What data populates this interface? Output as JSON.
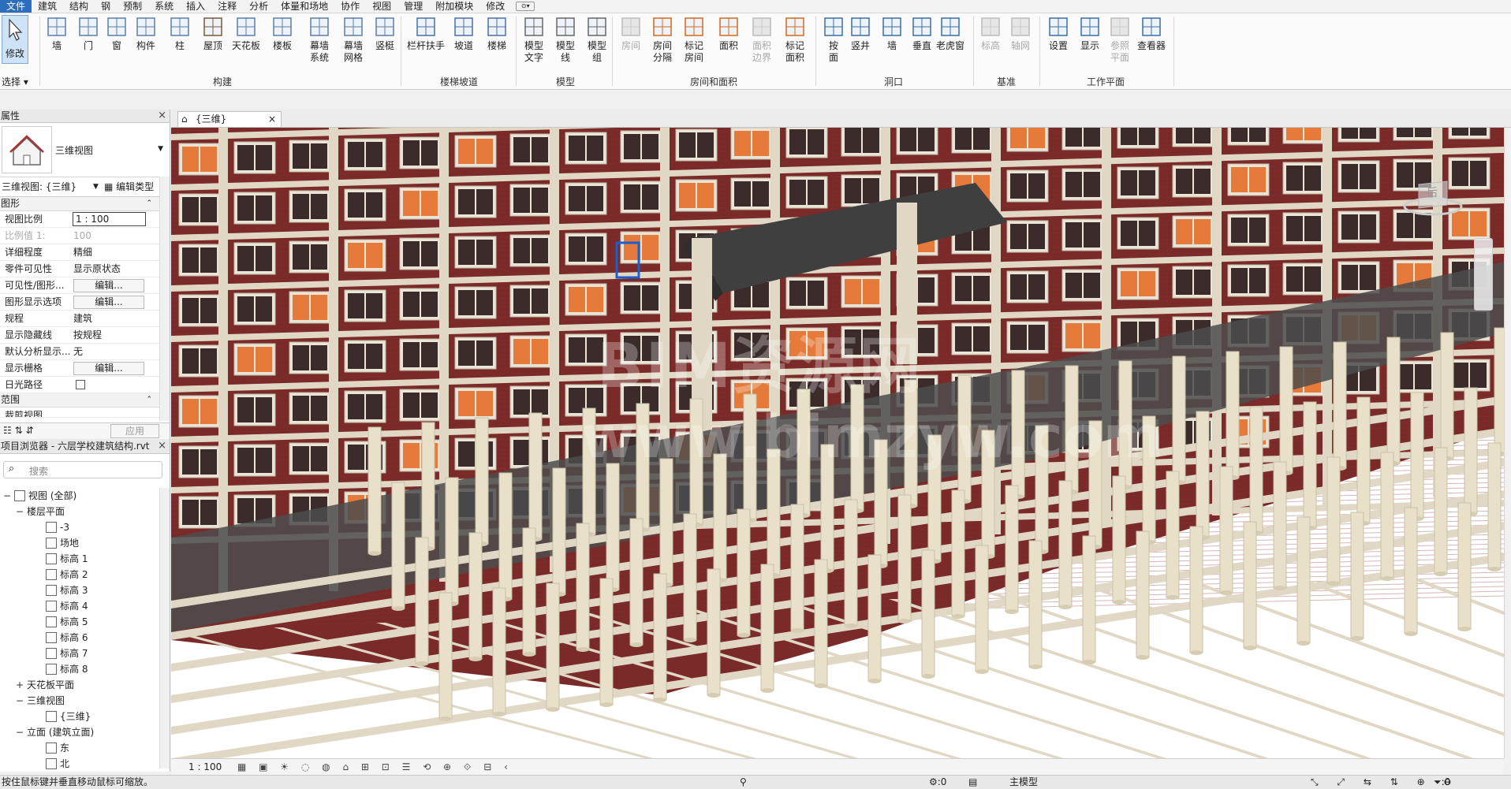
{
  "menu": {
    "items": [
      "文件",
      "建筑",
      "结构",
      "钢",
      "预制",
      "系统",
      "插入",
      "注释",
      "分析",
      "体量和场地",
      "协作",
      "视图",
      "管理",
      "附加模块",
      "修改"
    ]
  },
  "ribbon": {
    "select_label": "选择",
    "modify": "修改",
    "build_buttons": [
      "墙",
      "门",
      "窗",
      "构件",
      "柱",
      "屋顶",
      "天花板",
      "楼板",
      "幕墙\n系统",
      "幕墙\n网格",
      "竖梃"
    ],
    "build_group": "构建",
    "stair_buttons": [
      "栏杆扶手",
      "坡道",
      "楼梯"
    ],
    "stair_group": "楼梯坡道",
    "model_buttons": [
      "模型\n文字",
      "模型\n线",
      "模型\n组"
    ],
    "model_group": "模型",
    "room_buttons": [
      "房间",
      "房间\n分隔",
      "标记\n房间",
      "面积",
      "面积\n边界",
      "标记\n面积"
    ],
    "room_group": "房间和面积",
    "opening_buttons": [
      "按\n面",
      "竖井",
      "墙",
      "垂直",
      "老虎窗"
    ],
    "opening_group": "洞口",
    "datum_buttons": [
      "标高",
      "轴网"
    ],
    "datum_group": "基准",
    "workplane_buttons": [
      "设置",
      "显示",
      "参照\n平面",
      "查看器"
    ],
    "workplane_group": "工作平面"
  },
  "properties": {
    "title": "属性",
    "type_name": "三维视图",
    "view_selector": "三维视图: {三维}",
    "edit_type": "编辑类型",
    "section_graphics": "图形",
    "rows": [
      {
        "k": "视图比例",
        "v": "1 : 100",
        "kind": "input"
      },
      {
        "k": "比例值 1:",
        "v": "100",
        "kind": "gray"
      },
      {
        "k": "详细程度",
        "v": "精细",
        "kind": "text"
      },
      {
        "k": "零件可见性",
        "v": "显示原状态",
        "kind": "text"
      },
      {
        "k": "可见性/图形...",
        "v": "编辑...",
        "kind": "button"
      },
      {
        "k": "图形显示选项",
        "v": "编辑...",
        "kind": "button"
      },
      {
        "k": "规程",
        "v": "建筑",
        "kind": "text"
      },
      {
        "k": "显示隐藏线",
        "v": "按规程",
        "kind": "text"
      },
      {
        "k": "默认分析显示...",
        "v": "无",
        "kind": "text"
      },
      {
        "k": "显示栅格",
        "v": "编辑...",
        "kind": "button"
      },
      {
        "k": "日光路径",
        "v": "",
        "kind": "check"
      }
    ],
    "section_extents": "范围",
    "crop_row": "裁剪视图",
    "apply": "应用"
  },
  "browser": {
    "title": "项目浏览器 - 六层学校建筑结构.rvt",
    "search_placeholder": "搜索",
    "tree": [
      {
        "lvl": 0,
        "pm": "−",
        "icon": true,
        "label": "视图 (全部)"
      },
      {
        "lvl": 1,
        "pm": "−",
        "icon": false,
        "label": "楼层平面"
      },
      {
        "lvl": 2,
        "pm": "",
        "icon": true,
        "label": "-3"
      },
      {
        "lvl": 2,
        "pm": "",
        "icon": true,
        "label": "场地"
      },
      {
        "lvl": 2,
        "pm": "",
        "icon": true,
        "label": "标高 1"
      },
      {
        "lvl": 2,
        "pm": "",
        "icon": true,
        "label": "标高 2"
      },
      {
        "lvl": 2,
        "pm": "",
        "icon": true,
        "label": "标高 3"
      },
      {
        "lvl": 2,
        "pm": "",
        "icon": true,
        "label": "标高 4"
      },
      {
        "lvl": 2,
        "pm": "",
        "icon": true,
        "label": "标高 5"
      },
      {
        "lvl": 2,
        "pm": "",
        "icon": true,
        "label": "标高 6"
      },
      {
        "lvl": 2,
        "pm": "",
        "icon": true,
        "label": "标高 7"
      },
      {
        "lvl": 2,
        "pm": "",
        "icon": true,
        "label": "标高 8"
      },
      {
        "lvl": 1,
        "pm": "+",
        "icon": false,
        "label": "天花板平面"
      },
      {
        "lvl": 1,
        "pm": "−",
        "icon": false,
        "label": "三维视图"
      },
      {
        "lvl": 2,
        "pm": "",
        "icon": true,
        "label": "{三维}"
      },
      {
        "lvl": 1,
        "pm": "−",
        "icon": false,
        "label": "立面 (建筑立面)"
      },
      {
        "lvl": 2,
        "pm": "",
        "icon": true,
        "label": "东"
      },
      {
        "lvl": 2,
        "pm": "",
        "icon": true,
        "label": "北"
      }
    ]
  },
  "view": {
    "tab_title": "{三维}",
    "scale": "1 : 100",
    "watermark_line1": "BIM资源网",
    "watermark_line2": "www.bimzyw.com",
    "viewcube": "后"
  },
  "status": {
    "hint": "按住鼠标键并垂直移动鼠标可缩放。",
    "workset": ":0",
    "model": "主模型",
    "filter": ":0"
  },
  "colors": {
    "brick": "#7a2a28",
    "frame": "#e0d8c4",
    "slab": "#4c4c4c",
    "window": "#e57a3a",
    "accent": "#2a6ebd"
  }
}
